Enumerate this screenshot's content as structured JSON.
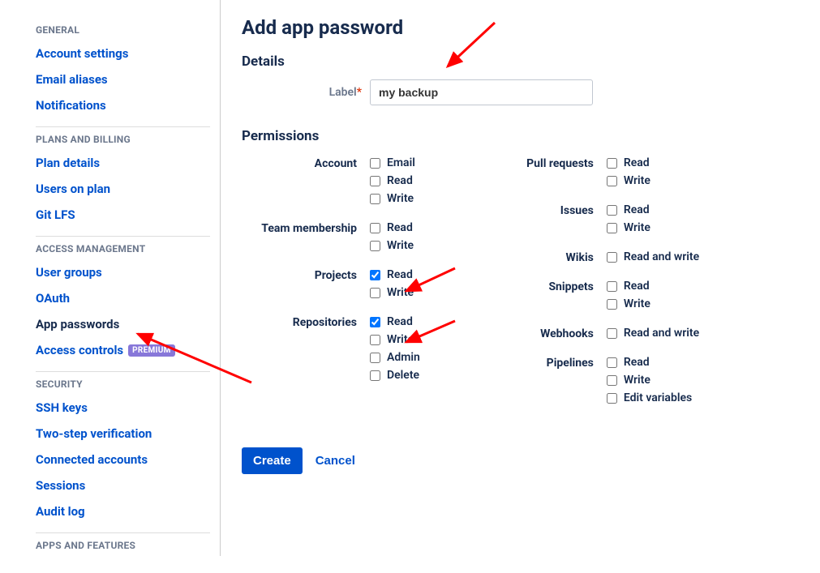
{
  "sidebar": {
    "sections": [
      {
        "title": "GENERAL",
        "items": [
          "Account settings",
          "Email aliases",
          "Notifications"
        ]
      },
      {
        "title": "PLANS AND BILLING",
        "items": [
          "Plan details",
          "Users on plan",
          "Git LFS"
        ]
      },
      {
        "title": "ACCESS MANAGEMENT",
        "items": [
          "User groups",
          "OAuth",
          "App passwords",
          "Access controls"
        ],
        "active": "App passwords",
        "badge_on": "Access controls",
        "badge": "PREMIUM"
      },
      {
        "title": "SECURITY",
        "items": [
          "SSH keys",
          "Two-step verification",
          "Connected accounts",
          "Sessions",
          "Audit log"
        ]
      },
      {
        "title": "APPS AND FEATURES",
        "items": []
      }
    ]
  },
  "main": {
    "title": "Add app password",
    "details_heading": "Details",
    "label_field_label": "Label",
    "label_field_value": "my backup",
    "permissions_heading": "Permissions",
    "col_a": [
      {
        "label": "Account",
        "opts": [
          {
            "t": "Email",
            "c": false
          },
          {
            "t": "Read",
            "c": false
          },
          {
            "t": "Write",
            "c": false
          }
        ]
      },
      {
        "label": "Team membership",
        "opts": [
          {
            "t": "Read",
            "c": false
          },
          {
            "t": "Write",
            "c": false
          }
        ]
      },
      {
        "label": "Projects",
        "opts": [
          {
            "t": "Read",
            "c": true
          },
          {
            "t": "Write",
            "c": false
          }
        ]
      },
      {
        "label": "Repositories",
        "opts": [
          {
            "t": "Read",
            "c": true
          },
          {
            "t": "Write",
            "c": false
          },
          {
            "t": "Admin",
            "c": false
          },
          {
            "t": "Delete",
            "c": false
          }
        ]
      }
    ],
    "col_b": [
      {
        "label": "Pull requests",
        "opts": [
          {
            "t": "Read",
            "c": false
          },
          {
            "t": "Write",
            "c": false
          }
        ]
      },
      {
        "label": "Issues",
        "opts": [
          {
            "t": "Read",
            "c": false
          },
          {
            "t": "Write",
            "c": false
          }
        ]
      },
      {
        "label": "Wikis",
        "opts": [
          {
            "t": "Read and write",
            "c": false
          }
        ]
      },
      {
        "label": "Snippets",
        "opts": [
          {
            "t": "Read",
            "c": false
          },
          {
            "t": "Write",
            "c": false
          }
        ]
      },
      {
        "label": "Webhooks",
        "opts": [
          {
            "t": "Read and write",
            "c": false
          }
        ]
      },
      {
        "label": "Pipelines",
        "opts": [
          {
            "t": "Read",
            "c": false
          },
          {
            "t": "Write",
            "c": false
          },
          {
            "t": "Edit variables",
            "c": false
          }
        ]
      }
    ],
    "create_label": "Create",
    "cancel_label": "Cancel"
  }
}
